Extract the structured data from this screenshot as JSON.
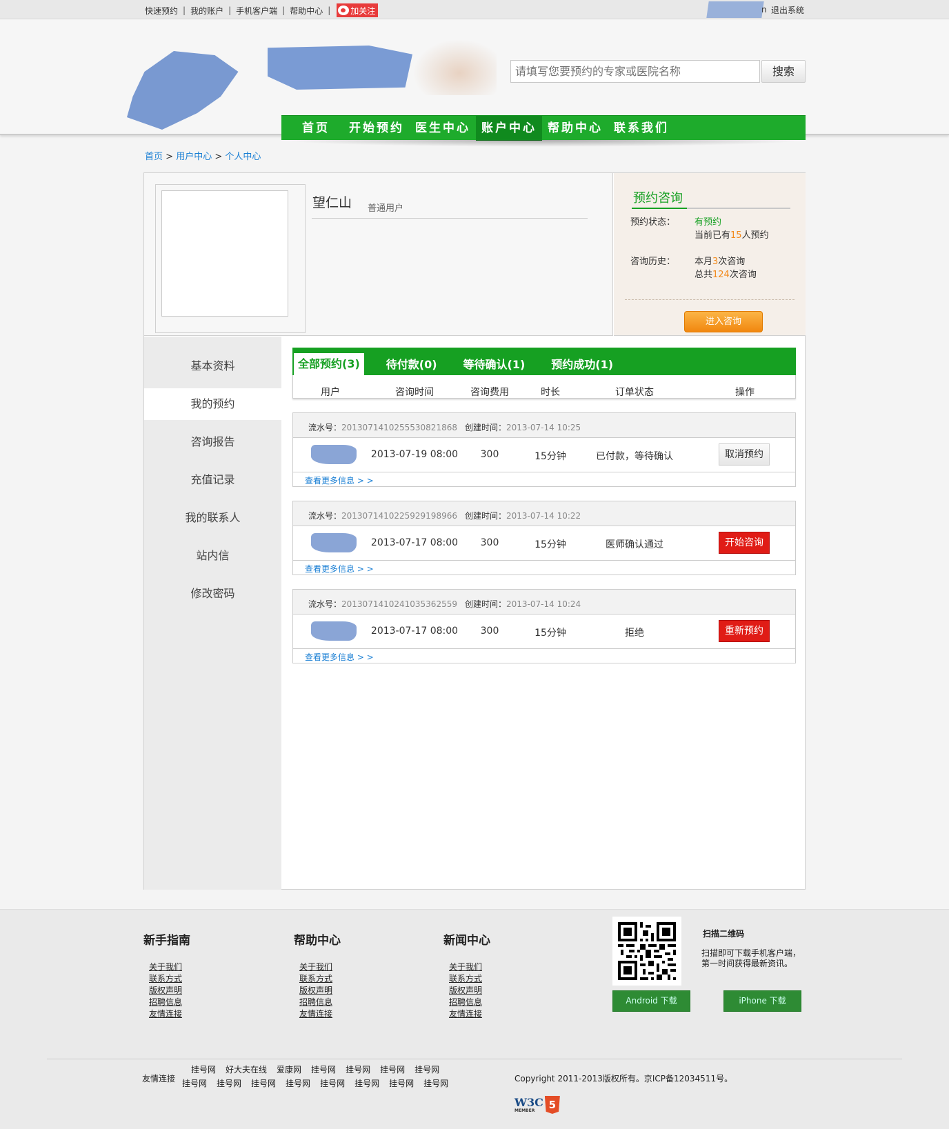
{
  "topbar": {
    "links": [
      "快速预约",
      "我的账户",
      "手机客户端",
      "帮助中心"
    ],
    "weibo_label": "加关注",
    "username_suffix": "n",
    "logout": "退出系统"
  },
  "header": {
    "search_placeholder": "请填写您要预约的专家或医院名称",
    "search_button": "搜索",
    "nav": [
      "首页",
      "开始预约",
      "医生中心",
      "账户中心",
      "帮助中心",
      "联系我们"
    ],
    "nav_active": "账户中心"
  },
  "breadcrumb": [
    "首页",
    "用户中心",
    "个人中心"
  ],
  "profile": {
    "name": "望仁山",
    "role": "普通用户"
  },
  "consult": {
    "title": "预约咨询",
    "status_label": "预约状态：",
    "status_value": "有预约",
    "queue_prefix": "当前已有",
    "queue_count": "15",
    "queue_suffix": "人预约",
    "history_label": "咨询历史：",
    "month_prefix": "本月",
    "month_count": "3",
    "month_suffix": "次咨询",
    "total_prefix": "总共",
    "total_count": "124",
    "total_suffix": "次咨询",
    "enter_button": "进入咨询"
  },
  "sidebar": {
    "items": [
      "基本资料",
      "我的预约",
      "咨询报告",
      "充值记录",
      "我的联系人",
      "站内信",
      "修改密码"
    ],
    "active": "我的预约"
  },
  "tabs": [
    "全部预约(3)",
    "待付款(0)",
    "等待确认(1)",
    "预约成功(1)"
  ],
  "table_headers": [
    "用户",
    "咨询时间",
    "咨询费用",
    "时长",
    "订单状态",
    "操作"
  ],
  "orders": [
    {
      "serial_label": "流水号：",
      "serial": "20130714102555308​21868",
      "created_label": "创建时间：",
      "created": "2013-07-14 10:25",
      "time": "2013-07-19 08:00",
      "fee": "300",
      "duration": "15分钟",
      "status": "已付款，等待确认",
      "action": "取消预约",
      "more": "查看更多信息 > >"
    },
    {
      "serial_label": "流水号：",
      "serial": "201307141022592919​8966",
      "created_label": "创建时间：",
      "created": "2013-07-14 10:22",
      "time": "2013-07-17 08:00",
      "fee": "300",
      "duration": "15分钟",
      "status": "医师确认通过",
      "action": "开始咨询",
      "more": "查看更多信息 > >"
    },
    {
      "serial_label": "流水号：",
      "serial": "20130714102410353​62559",
      "created_label": "创建时间：",
      "created": "2013-07-14 10:24",
      "time": "2013-07-17 08:00",
      "fee": "300",
      "duration": "15分钟",
      "status": "拒绝",
      "action": "重新预约",
      "more": "查看更多信息 > >"
    }
  ],
  "footer": {
    "columns": [
      {
        "title": "新手指南",
        "links": [
          "关于我们",
          "联系方式",
          "版权声明",
          "招聘信息",
          "友情连接"
        ]
      },
      {
        "title": "帮助中心",
        "links": [
          "关于我们",
          "联系方式",
          "版权声明",
          "招聘信息",
          "友情连接"
        ]
      },
      {
        "title": "新闻中心",
        "links": [
          "关于我们",
          "联系方式",
          "版权声明",
          "招聘信息",
          "友情连接"
        ]
      }
    ],
    "qr_title": "扫描二维码",
    "qr_desc": "扫描即可下载手机客户端，第一时间获得最新资讯。",
    "android_button": "Android 下载",
    "iphone_button": "iPhone 下载",
    "friend_label": "友情连接",
    "friend_links_row1": [
      "挂号网",
      "好大夫在线",
      "爱康网",
      "挂号网",
      "挂号网",
      "挂号网",
      "挂号网"
    ],
    "friend_links_row2": [
      "挂号网",
      "挂号网",
      "挂号网",
      "挂号网",
      "挂号网",
      "挂号网",
      "挂号网",
      "挂号网"
    ],
    "copyright": "Copyright 2011-2013版权所有。京ICP备12034511号。",
    "w3c_text": "W3C",
    "w3c_sub": "MEMBER",
    "html5_text": "5"
  },
  "colors": {
    "brand_green": "#16a022",
    "nav_green": "#1eab2c",
    "link_blue": "#1a7fd4",
    "accent_orange": "#f28a1c",
    "danger_red": "#e01c16"
  }
}
